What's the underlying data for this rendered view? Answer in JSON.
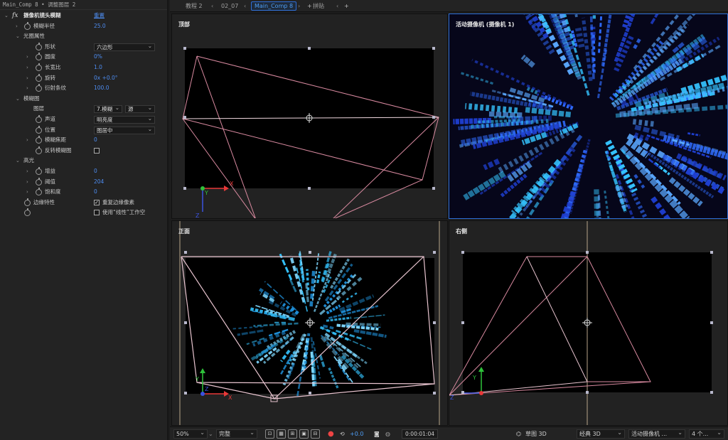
{
  "effects_panel": {
    "title": "Main_Comp 8 • 调整图层 2",
    "effect_name": "摄像机镜头模糊",
    "reset_label": "重置",
    "rows": [
      {
        "label": "模糊半径",
        "value": "25.0"
      },
      {
        "label": "光圈属性"
      },
      {
        "label": "形状",
        "select": "六边形"
      },
      {
        "label": "圆度",
        "value": "0%"
      },
      {
        "label": "长宽比",
        "value": "1.0"
      },
      {
        "label": "旋转",
        "value": "0x +0.0°"
      },
      {
        "label": "衍射条纹",
        "value": "100.0"
      },
      {
        "label": "模糊图"
      },
      {
        "label": "图层",
        "select": "7.模糊",
        "select2": "源"
      },
      {
        "label": "声道",
        "select": "明亮度"
      },
      {
        "label": "位置",
        "select": "图居中"
      },
      {
        "label": "模糊焦距",
        "value": "0"
      },
      {
        "label": "反转模糊图"
      },
      {
        "label": "高光"
      },
      {
        "label": "增益",
        "value": "0"
      },
      {
        "label": "阈值",
        "value": "204"
      },
      {
        "label": "饱和度",
        "value": "0"
      },
      {
        "label": "边缘特性",
        "check_label": "重复边缘像素"
      },
      {
        "check_label": "使用“线性”工作空"
      }
    ]
  },
  "tabs": {
    "prev_tab": "教程 2",
    "tab2": "02_07",
    "active_tab": "Main_Comp 8",
    "paste_label": "拼贴"
  },
  "viewports": {
    "top": "顶部",
    "camera": "活动摄像机 (摄像机 1)",
    "front": "正面",
    "right": "右侧"
  },
  "axes": {
    "x": "X",
    "y": "Y",
    "z": "Z"
  },
  "toolbar": {
    "zoom": "50%",
    "resolution": "完整",
    "exposure": "+0.0",
    "timecode": "0:00:01:04",
    "draft3d": "草图 3D",
    "renderer": "经典 3D",
    "camera": "活动摄像机 ...",
    "views": "4 个..."
  },
  "colors": {
    "accent_blue": "#4d9df5",
    "wire_pink": "#e07a8e",
    "star_blue": "#2f6cff",
    "star_cyan": "#35c4ff"
  }
}
